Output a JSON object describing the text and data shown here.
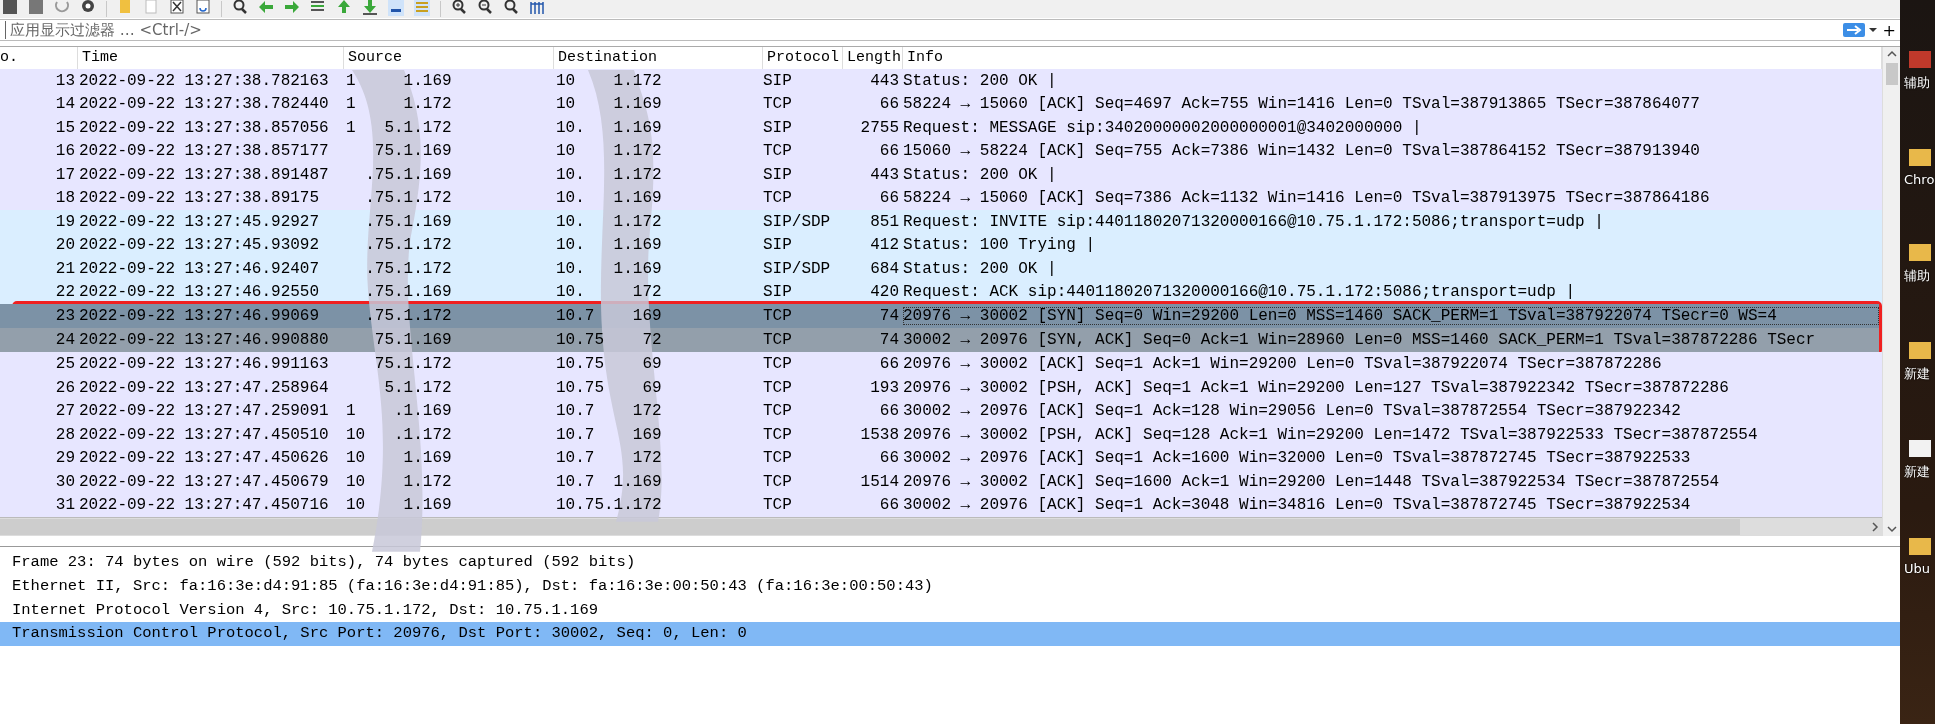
{
  "filter": {
    "placeholder": "应用显示过滤器 … <Ctrl-/>",
    "add_label": "+"
  },
  "packet_list": {
    "columns": [
      "o.",
      "Time",
      "Source",
      "Destination",
      "Protocol",
      "Length",
      "Info"
    ],
    "rows": [
      {
        "no": "13",
        "time": "2022-09-22 13:27:38.782163",
        "source_head": "1",
        "source_tail": "1.169",
        "dest_head": "10",
        "dest_tail": "1.172",
        "protocol": "SIP",
        "length": "443",
        "info": "Status: 200 OK |",
        "color": "#e7e6ff",
        "selected": false,
        "boxed": false
      },
      {
        "no": "14",
        "time": "2022-09-22 13:27:38.782440",
        "source_head": "1",
        "source_tail": "1.172",
        "dest_head": "10",
        "dest_tail": "1.169",
        "protocol": "TCP",
        "length": "66",
        "info": "58224 → 15060 [ACK] Seq=4697 Ack=755 Win=1416 Len=0 TSval=387913865 TSecr=387864077",
        "color": "#e7e6ff",
        "selected": false,
        "boxed": false
      },
      {
        "no": "15",
        "time": "2022-09-22 13:27:38.857056",
        "source_head": "1",
        "source_tail": "5.1.172",
        "dest_head": "10.",
        "dest_tail": "1.169",
        "protocol": "SIP",
        "length": "2755",
        "info": "Request: MESSAGE sip:34020000002000000001@3402000000 |",
        "color": "#e7e6ff",
        "selected": false,
        "boxed": false
      },
      {
        "no": "16",
        "time": "2022-09-22 13:27:38.857177",
        "source_head": "",
        "source_tail": "75.1.169",
        "dest_head": "10",
        "dest_tail": "1.172",
        "protocol": "TCP",
        "length": "66",
        "info": "15060 → 58224 [ACK] Seq=755 Ack=7386 Win=1432 Len=0 TSval=387864152 TSecr=387913940",
        "color": "#e7e6ff",
        "selected": false,
        "boxed": false
      },
      {
        "no": "17",
        "time": "2022-09-22 13:27:38.891487",
        "source_head": "",
        "source_tail": ".75.1.169",
        "dest_head": "10.",
        "dest_tail": "1.172",
        "protocol": "SIP",
        "length": "443",
        "info": "Status: 200 OK |",
        "color": "#e7e6ff",
        "selected": false,
        "boxed": false
      },
      {
        "no": "18",
        "time": "2022-09-22 13:27:38.89175",
        "source_head": "",
        "source_tail": ".75.1.172",
        "dest_head": "10.",
        "dest_tail": "1.169",
        "protocol": "TCP",
        "length": "66",
        "info": "58224 → 15060 [ACK] Seq=7386 Ack=1132 Win=1416 Len=0 TSval=387913975 TSecr=387864186",
        "color": "#e7e6ff",
        "selected": false,
        "boxed": false
      },
      {
        "no": "19",
        "time": "2022-09-22 13:27:45.92927",
        "source_head": "",
        "source_tail": ".75.1.169",
        "dest_head": "10.",
        "dest_tail": "1.172",
        "protocol": "SIP/SDP",
        "length": "851",
        "info": "Request: INVITE sip:44011802071320000166@10.75.1.172:5086;transport=udp |",
        "color": "#daeeff",
        "selected": false,
        "boxed": false
      },
      {
        "no": "20",
        "time": "2022-09-22 13:27:45.93092",
        "source_head": "",
        "source_tail": ".75.1.172",
        "dest_head": "10.",
        "dest_tail": "1.169",
        "protocol": "SIP",
        "length": "412",
        "info": "Status: 100 Trying |",
        "color": "#daeeff",
        "selected": false,
        "boxed": false
      },
      {
        "no": "21",
        "time": "2022-09-22 13:27:46.92407",
        "source_head": "",
        "source_tail": ".75.1.172",
        "dest_head": "10.",
        "dest_tail": "1.169",
        "protocol": "SIP/SDP",
        "length": "684",
        "info": "Status: 200 OK |",
        "color": "#daeeff",
        "selected": false,
        "boxed": false
      },
      {
        "no": "22",
        "time": "2022-09-22 13:27:46.92550",
        "source_head": "",
        "source_tail": ".75.1.169",
        "dest_head": "10.",
        "dest_tail": "172",
        "protocol": "SIP",
        "length": "420",
        "info": "Request: ACK sip:44011802071320000166@10.75.1.172:5086;transport=udp |",
        "color": "#daeeff",
        "selected": false,
        "boxed": false
      },
      {
        "no": "23",
        "time": "2022-09-22 13:27:46.99069",
        "source_head": "",
        "source_tail": ".75.1.172",
        "dest_head": "10.7",
        "dest_tail": "169",
        "protocol": "TCP",
        "length": "74",
        "info": "20976 → 30002 [SYN] Seq=0 Win=29200 Len=0 MSS=1460 SACK_PERM=1 TSval=387922074 TSecr=0 WS=4",
        "color": "#7c92a6",
        "selected": true,
        "boxed": true
      },
      {
        "no": "24",
        "time": "2022-09-22 13:27:46.990880",
        "source_head": "",
        "source_tail": "75.1.169",
        "dest_head": "10.75",
        "dest_tail": "72",
        "protocol": "TCP",
        "length": "74",
        "info": "30002 → 20976 [SYN, ACK] Seq=0 Ack=1 Win=28960 Len=0 MSS=1460 SACK_PERM=1 TSval=387872286 TSecr",
        "color": "#939fab",
        "selected": false,
        "boxed": true
      },
      {
        "no": "25",
        "time": "2022-09-22 13:27:46.991163",
        "source_head": "",
        "source_tail": "75.1.172",
        "dest_head": "10.75",
        "dest_tail": "69",
        "protocol": "TCP",
        "length": "66",
        "info": "20976 → 30002 [ACK] Seq=1 Ack=1 Win=29200 Len=0 TSval=387922074 TSecr=387872286",
        "color": "#e7e6ff",
        "selected": false,
        "boxed": false
      },
      {
        "no": "26",
        "time": "2022-09-22 13:27:47.258964",
        "source_head": "",
        "source_tail": "5.1.172",
        "dest_head": "10.75",
        "dest_tail": "69",
        "protocol": "TCP",
        "length": "193",
        "info": "20976 → 30002 [PSH, ACK] Seq=1 Ack=1 Win=29200 Len=127 TSval=387922342 TSecr=387872286",
        "color": "#e7e6ff",
        "selected": false,
        "boxed": false
      },
      {
        "no": "27",
        "time": "2022-09-22 13:27:47.259091",
        "source_head": "1",
        "source_tail": ".1.169",
        "dest_head": "10.7",
        "dest_tail": "172",
        "protocol": "TCP",
        "length": "66",
        "info": "30002 → 20976 [ACK] Seq=1 Ack=128 Win=29056 Len=0 TSval=387872554 TSecr=387922342",
        "color": "#e7e6ff",
        "selected": false,
        "boxed": false
      },
      {
        "no": "28",
        "time": "2022-09-22 13:27:47.450510",
        "source_head": "10",
        "source_tail": ".1.172",
        "dest_head": "10.7",
        "dest_tail": "169",
        "protocol": "TCP",
        "length": "1538",
        "info": "20976 → 30002 [PSH, ACK] Seq=128 Ack=1 Win=29200 Len=1472 TSval=387922533 TSecr=387872554",
        "color": "#e7e6ff",
        "selected": false,
        "boxed": false
      },
      {
        "no": "29",
        "time": "2022-09-22 13:27:47.450626",
        "source_head": "10",
        "source_tail": "1.169",
        "dest_head": "10.7",
        "dest_tail": "172",
        "protocol": "TCP",
        "length": "66",
        "info": "30002 → 20976 [ACK] Seq=1 Ack=1600 Win=32000 Len=0 TSval=387872745 TSecr=387922533",
        "color": "#e7e6ff",
        "selected": false,
        "boxed": false
      },
      {
        "no": "30",
        "time": "2022-09-22 13:27:47.450679",
        "source_head": "10",
        "source_tail": "1.172",
        "dest_head": "10.7",
        "dest_tail": "1.169",
        "protocol": "TCP",
        "length": "1514",
        "info": "20976 → 30002 [ACK] Seq=1600 Ack=1 Win=29200 Len=1448 TSval=387922534 TSecr=387872554",
        "color": "#e7e6ff",
        "selected": false,
        "boxed": false
      },
      {
        "no": "31",
        "time": "2022-09-22 13:27:47.450716",
        "source_head": "10",
        "source_tail": "1.169",
        "dest_head": "10.75.1.172",
        "dest_tail": "",
        "protocol": "TCP",
        "length": "66",
        "info": "30002 → 20976 [ACK] Seq=1 Ack=3048 Win=34816 Len=0 TSval=387872745 TSecr=387922534",
        "color": "#e7e6ff",
        "selected": false,
        "boxed": false
      }
    ]
  },
  "details": [
    {
      "text": "Frame 23: 74 bytes on wire (592 bits), 74 bytes captured (592 bits)",
      "selected": false
    },
    {
      "text": "Ethernet II, Src: fa:16:3e:d4:91:85 (fa:16:3e:d4:91:85), Dst: fa:16:3e:00:50:43 (fa:16:3e:00:50:43)",
      "selected": false
    },
    {
      "text": "Internet Protocol Version 4, Src: 10.75.1.172, Dst: 10.75.1.169",
      "selected": false
    },
    {
      "text": "Transmission Control Protocol, Src Port: 20976, Dst Port: 30002, Seq: 0, Len: 0",
      "selected": true
    }
  ],
  "desktop_icons": [
    {
      "label": "辅助",
      "color": "#c0392b"
    },
    {
      "label": "Chro",
      "color": "#e8b84a"
    },
    {
      "label": "辅助",
      "color": "#e8b84a"
    },
    {
      "label": "新建",
      "color": "#e8b84a"
    },
    {
      "label": "新建",
      "color": "#f2f2f2"
    },
    {
      "label": "Ubu",
      "color": "#e8b84a"
    }
  ]
}
